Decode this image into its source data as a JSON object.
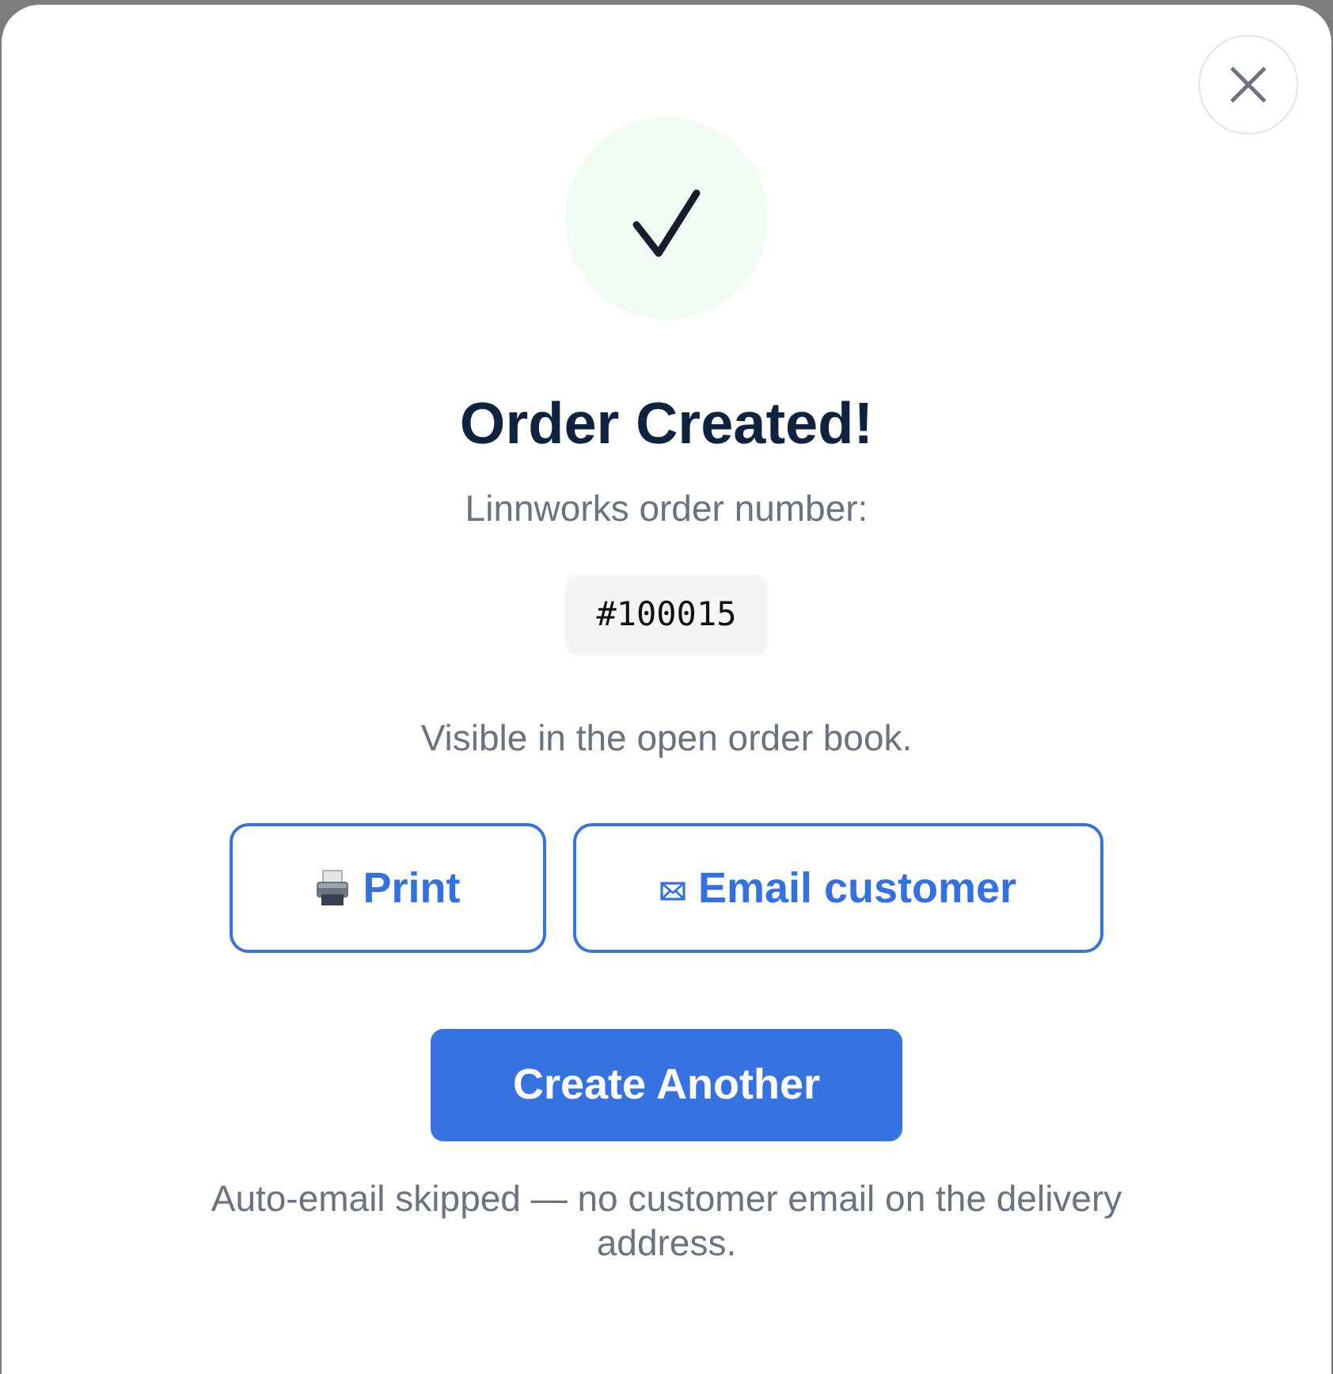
{
  "title": "Order Created!",
  "order_number_label": "Linnworks order number:",
  "order_number": "#100015",
  "note": "Visible in the open order book.",
  "actions": [
    {
      "kind": "print",
      "label": "Print"
    },
    {
      "kind": "email",
      "label": "Email customer"
    }
  ],
  "primary_button": "Create Another",
  "footer_note": "Auto-email skipped — no customer email on the delivery address."
}
